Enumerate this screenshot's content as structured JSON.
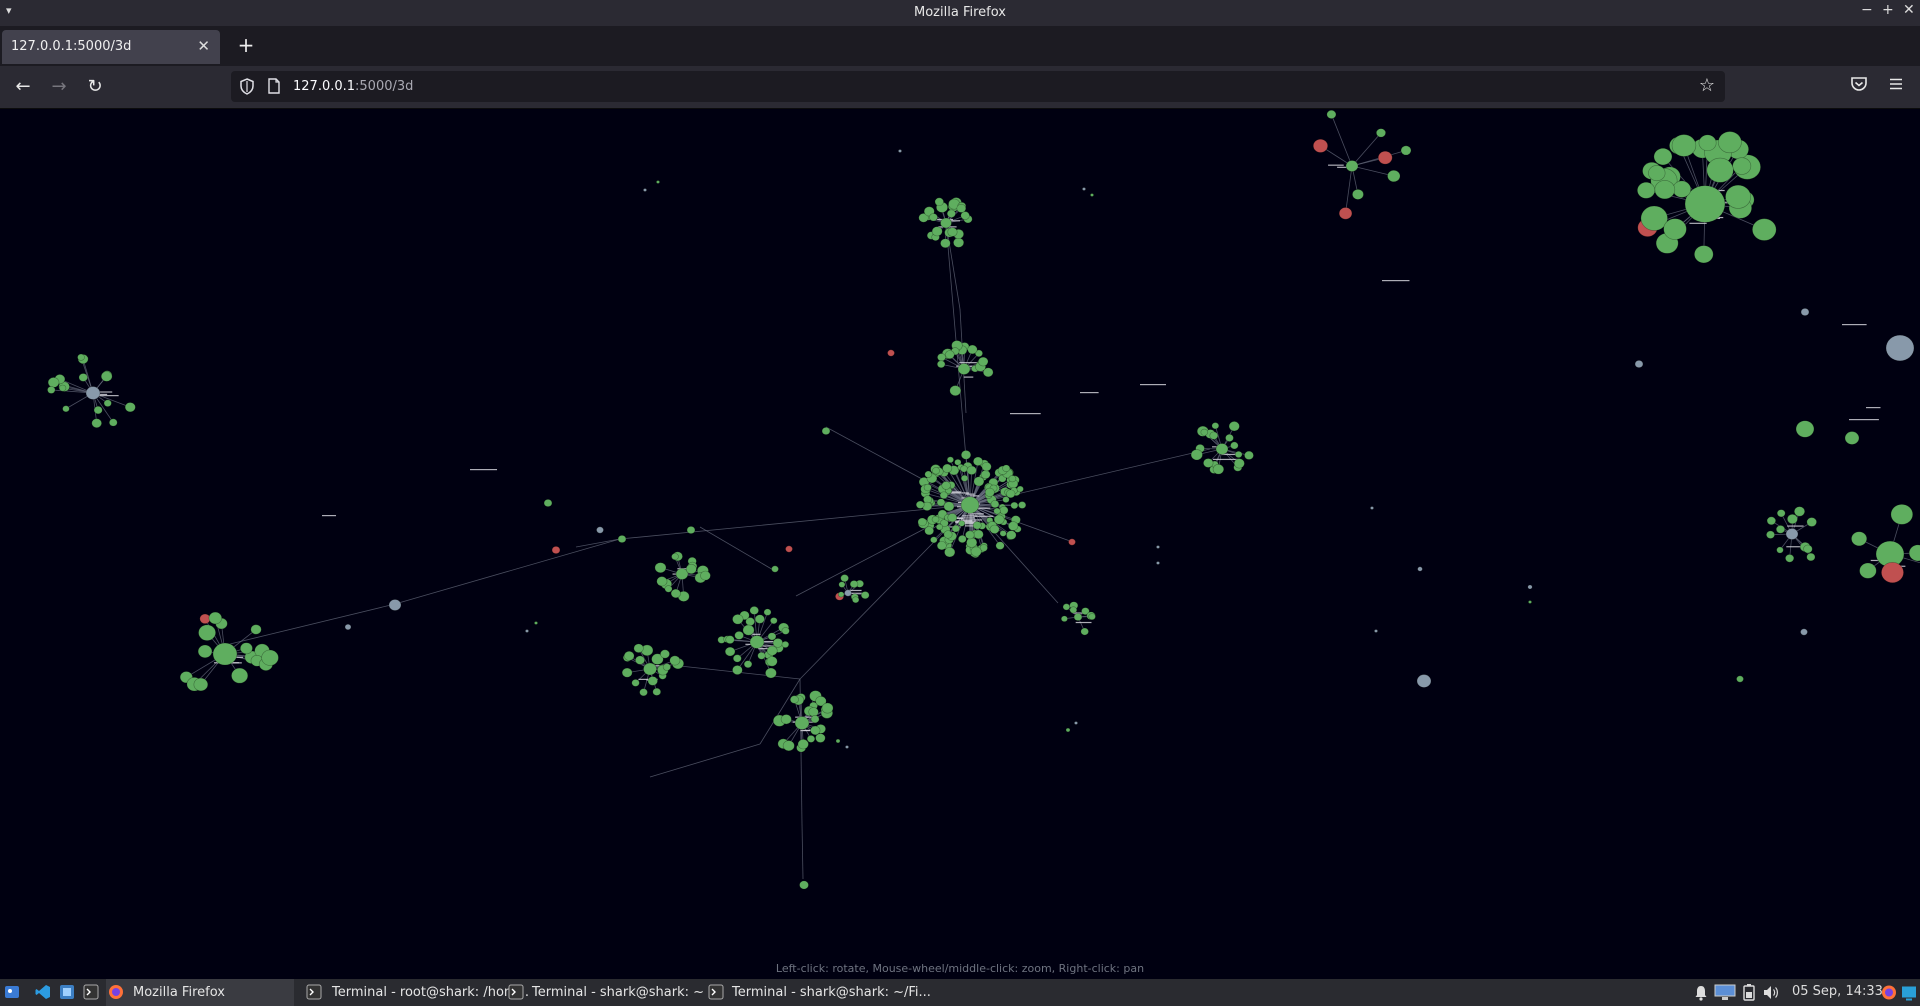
{
  "window": {
    "title": "Mozilla Firefox",
    "menu_arrow": "▾",
    "minimize": "−",
    "maximize": "+",
    "close": "✕"
  },
  "tabs": [
    {
      "label": "127.0.0.1:5000/3d",
      "close": "✕"
    }
  ],
  "new_tab": "+",
  "nav": {
    "back": "←",
    "forward": "→",
    "reload": "↻",
    "url_host": "127.0.0.1",
    "url_rest": ":5000/3d",
    "bookmark_icon": "star-icon",
    "pocket_icon": "pocket-icon",
    "menu_icon": "hamburger-menu-icon"
  },
  "graph": {
    "hint": "Left-click: rotate, Mouse-wheel/middle-click: zoom, Right-click: pan",
    "colors": {
      "background": "#000011",
      "node_green": "#5fae5f",
      "node_red": "#c05050",
      "node_grey": "#8899aa",
      "link": "#6a6f80"
    }
  },
  "taskbar": {
    "items": [
      {
        "label": "Mozilla Firefox",
        "icon": "firefox-icon"
      },
      {
        "label": "Terminal - root@shark: /hom...",
        "icon": "terminal-icon"
      },
      {
        "label": "Terminal - shark@shark: ~",
        "icon": "terminal-icon"
      },
      {
        "label": "Terminal - shark@shark: ~/Fi...",
        "icon": "terminal-icon"
      }
    ],
    "clock": "05 Sep, 14:33"
  }
}
